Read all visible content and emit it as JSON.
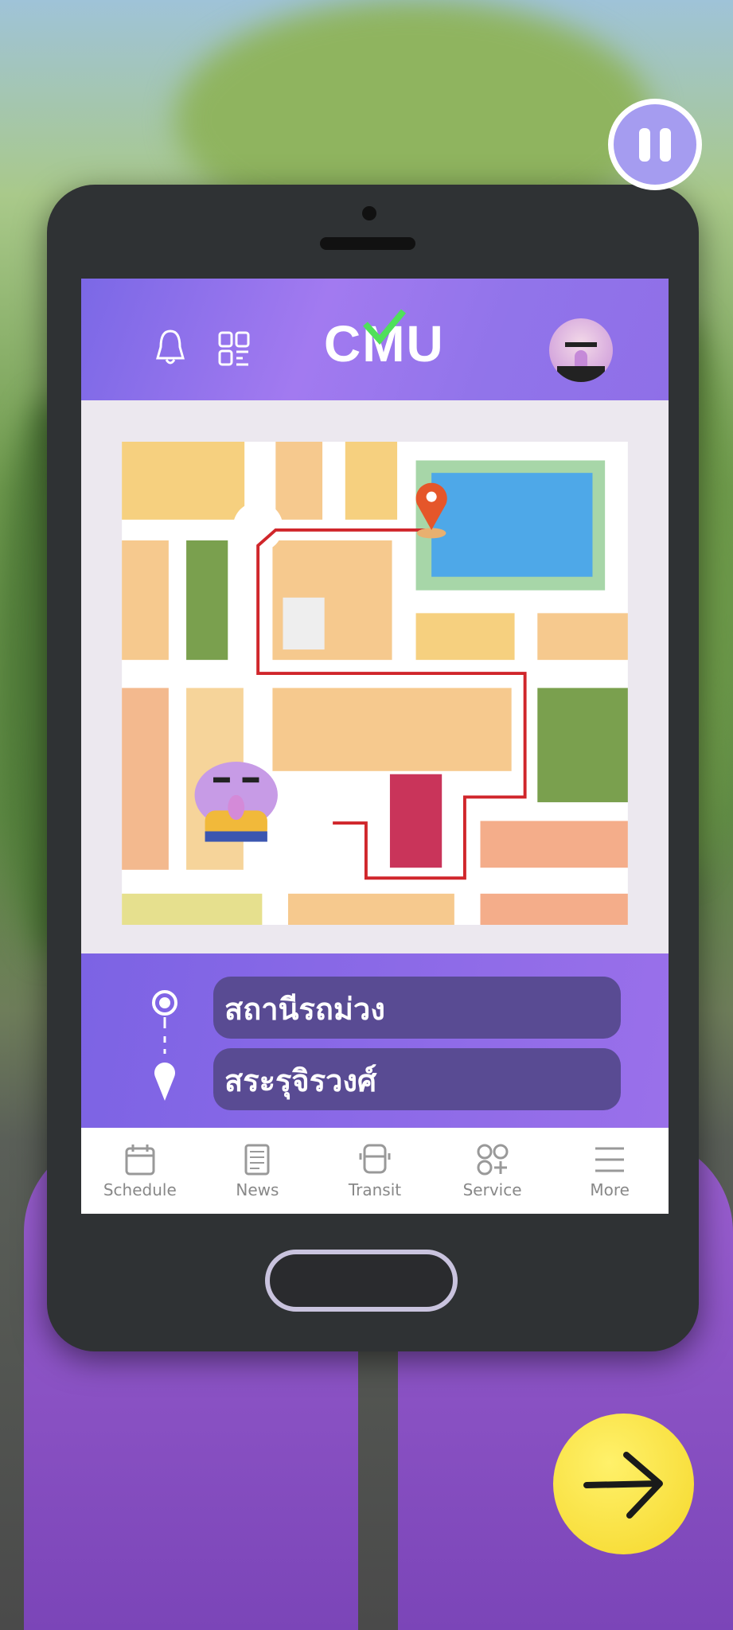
{
  "header": {
    "logo": "CMU",
    "icons": [
      "bell-icon",
      "qr-code-icon"
    ],
    "avatar": "player-avatar"
  },
  "route": {
    "origin": "สถานีรถม่วง",
    "destination": "สระรุจิรวงศ์"
  },
  "nav": [
    {
      "label": "Schedule",
      "icon": "calendar-icon"
    },
    {
      "label": "News",
      "icon": "newspaper-icon"
    },
    {
      "label": "Transit",
      "icon": "bus-icon"
    },
    {
      "label": "Service",
      "icon": "services-grid-icon"
    },
    {
      "label": "More",
      "icon": "menu-icon"
    }
  ],
  "controls": {
    "pause": "pause-icon",
    "next": "arrow-right-icon"
  },
  "colors": {
    "header": "#9a74ec",
    "route_line": "#d0262b",
    "field_bg": "#594b93",
    "next_button": "#f7dc33",
    "pause_button": "#a59cf0"
  }
}
